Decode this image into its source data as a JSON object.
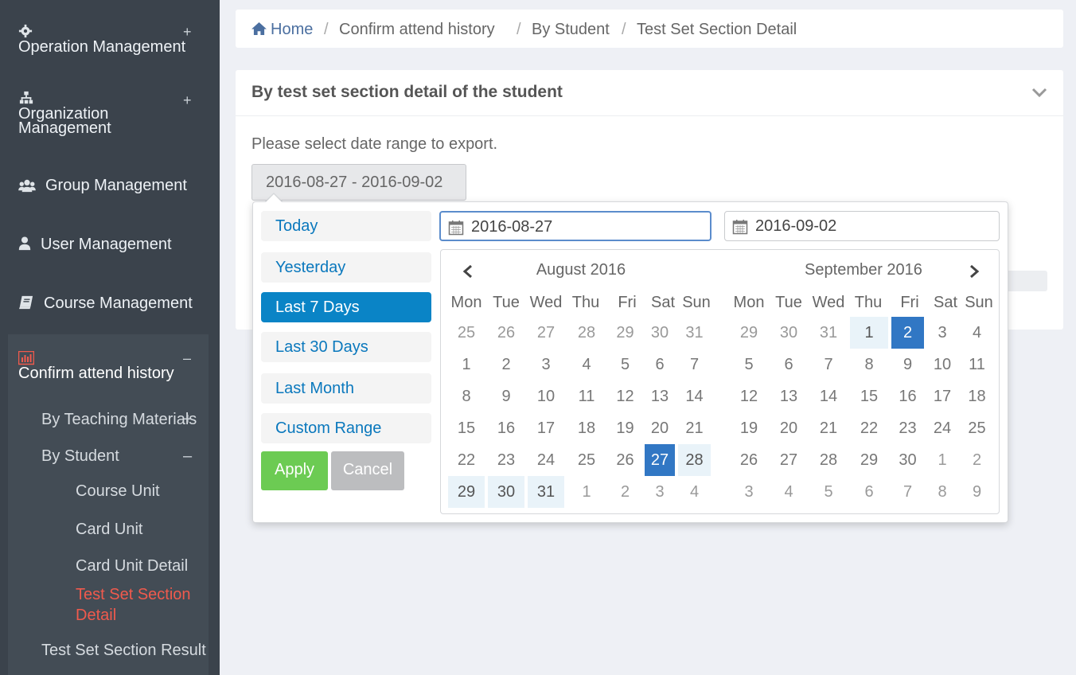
{
  "sidebar": {
    "items": [
      {
        "label": "Operation Management",
        "icon": "gear-icon",
        "toggle": "+"
      },
      {
        "label_line1": "Organization",
        "label_line2": "Management",
        "icon": "sitemap-icon",
        "toggle": "+"
      },
      {
        "label": "Group Management",
        "icon": "users-icon"
      },
      {
        "label": "User Management",
        "icon": "user-icon"
      },
      {
        "label": "Course Management",
        "icon": "book-icon"
      },
      {
        "label": "Confirm attend history",
        "icon": "bar-chart-icon",
        "toggle": "–"
      }
    ],
    "sub": {
      "by_teaching": "By Teaching Materials",
      "by_teaching_toggle": "+",
      "by_student": "By Student",
      "by_student_toggle": "–",
      "course_unit": "Course Unit",
      "card_unit": "Card Unit",
      "card_unit_detail": "Card Unit Detail",
      "test_set_section_detail_1": "Test Set Section",
      "test_set_section_detail_2": "Detail",
      "test_set_section_result": "Test Set Section Result"
    }
  },
  "breadcrumb": {
    "home": "Home",
    "sep": "/",
    "b1": "Confirm attend history",
    "b2": "By Student",
    "b3": "Test Set Section Detail"
  },
  "panel": {
    "title": "By test set section detail of the student",
    "hint": "Please select date range to export.",
    "range_value": "2016-08-27 - 2016-09-02"
  },
  "picker": {
    "ranges": [
      "Today",
      "Yesterday",
      "Last 7 Days",
      "Last 30 Days",
      "Last Month",
      "Custom Range"
    ],
    "active_range": "Last 7 Days",
    "apply": "Apply",
    "cancel": "Cancel",
    "start": "2016-08-27",
    "end": "2016-09-02",
    "dow": [
      "Mon",
      "Tue",
      "Wed",
      "Thu",
      "Fri",
      "Sat",
      "Sun"
    ],
    "left_month": "August 2016",
    "right_month": "September 2016",
    "left_days": [
      [
        "25",
        "26",
        "27",
        "28",
        "29",
        "30",
        "31"
      ],
      [
        "1",
        "2",
        "3",
        "4",
        "5",
        "6",
        "7"
      ],
      [
        "8",
        "9",
        "10",
        "11",
        "12",
        "13",
        "14"
      ],
      [
        "15",
        "16",
        "17",
        "18",
        "19",
        "20",
        "21"
      ],
      [
        "22",
        "23",
        "24",
        "25",
        "26",
        "27",
        "28"
      ],
      [
        "29",
        "30",
        "31",
        "1",
        "2",
        "3",
        "4"
      ]
    ],
    "right_days": [
      [
        "29",
        "30",
        "31",
        "1",
        "2",
        "3",
        "4"
      ],
      [
        "5",
        "6",
        "7",
        "8",
        "9",
        "10",
        "11"
      ],
      [
        "12",
        "13",
        "14",
        "15",
        "16",
        "17",
        "18"
      ],
      [
        "19",
        "20",
        "21",
        "22",
        "23",
        "24",
        "25"
      ],
      [
        "26",
        "27",
        "28",
        "29",
        "30",
        "1",
        "2"
      ],
      [
        "3",
        "4",
        "5",
        "6",
        "7",
        "8",
        "9"
      ]
    ]
  },
  "colors": {
    "sidebar_bg": "#3b434c",
    "active_text": "#f05a4d",
    "selected_day": "#3177c4",
    "range_day": "#e9f3f9",
    "apply_green": "#6ccb53",
    "active_range_blue": "#0a84c6"
  }
}
